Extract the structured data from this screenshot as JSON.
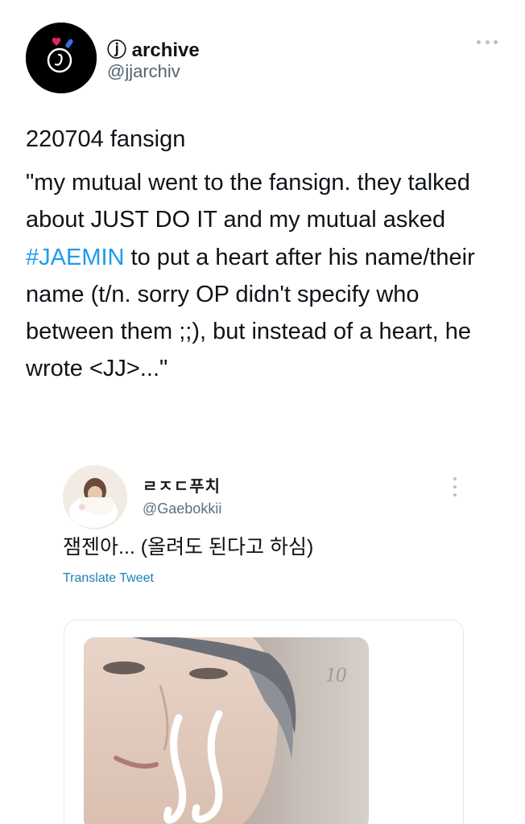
{
  "tweet": {
    "author_name": "ⓙ archive",
    "author_handle": "@jjarchiv",
    "date_line": "220704 fansign",
    "text_part1": "\"my mutual went to the fansign. they talked about JUST DO IT and my mutual asked ",
    "hashtag": "#JAEMIN",
    "text_part2": " to put a heart after his name/their name (t/n. sorry OP didn't specify who between them ;;), but instead of a heart, he wrote <JJ>...\"",
    "more_icon": "more-horizontal-icon"
  },
  "quoted_tweet": {
    "author_name": "ㄹㅈㄷ푸치",
    "author_handle": "@Gaebokkii",
    "text": "잼젠아... (올려도 된다고 하심)",
    "translate_label": "Translate Tweet",
    "more_icon": "more-vertical-icon"
  },
  "media": {
    "photo_writing": "JJ",
    "photo_number": "10"
  },
  "colors": {
    "link_blue": "#1d9bf0",
    "translate_blue": "#1d7fb8",
    "handle_gray": "#536471"
  }
}
